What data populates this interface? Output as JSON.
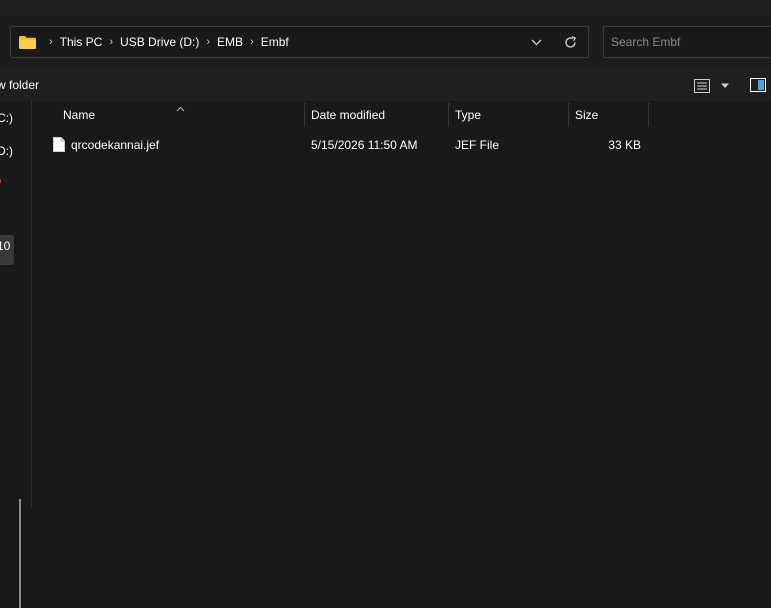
{
  "address": {
    "breadcrumbs": [
      "This PC",
      "USB Drive (D:)",
      "EMB",
      "Embf"
    ],
    "separator": "›"
  },
  "search": {
    "placeholder": "Search Embf",
    "value": ""
  },
  "commandbar": {
    "new_folder_label": "w folder"
  },
  "navpane": {
    "items": [
      "C:)",
      "D:)",
      "10"
    ]
  },
  "columns": {
    "name": "Name",
    "date_modified": "Date modified",
    "type": "Type",
    "size": "Size"
  },
  "files": [
    {
      "name": "qrcodekannai.jef",
      "date_modified": "5/15/2026 11:50 AM",
      "type": "JEF File",
      "size": "33 KB"
    }
  ],
  "colors": {
    "background": "#191919",
    "folder": "#f0c419",
    "accent": "#4aa3e0"
  }
}
